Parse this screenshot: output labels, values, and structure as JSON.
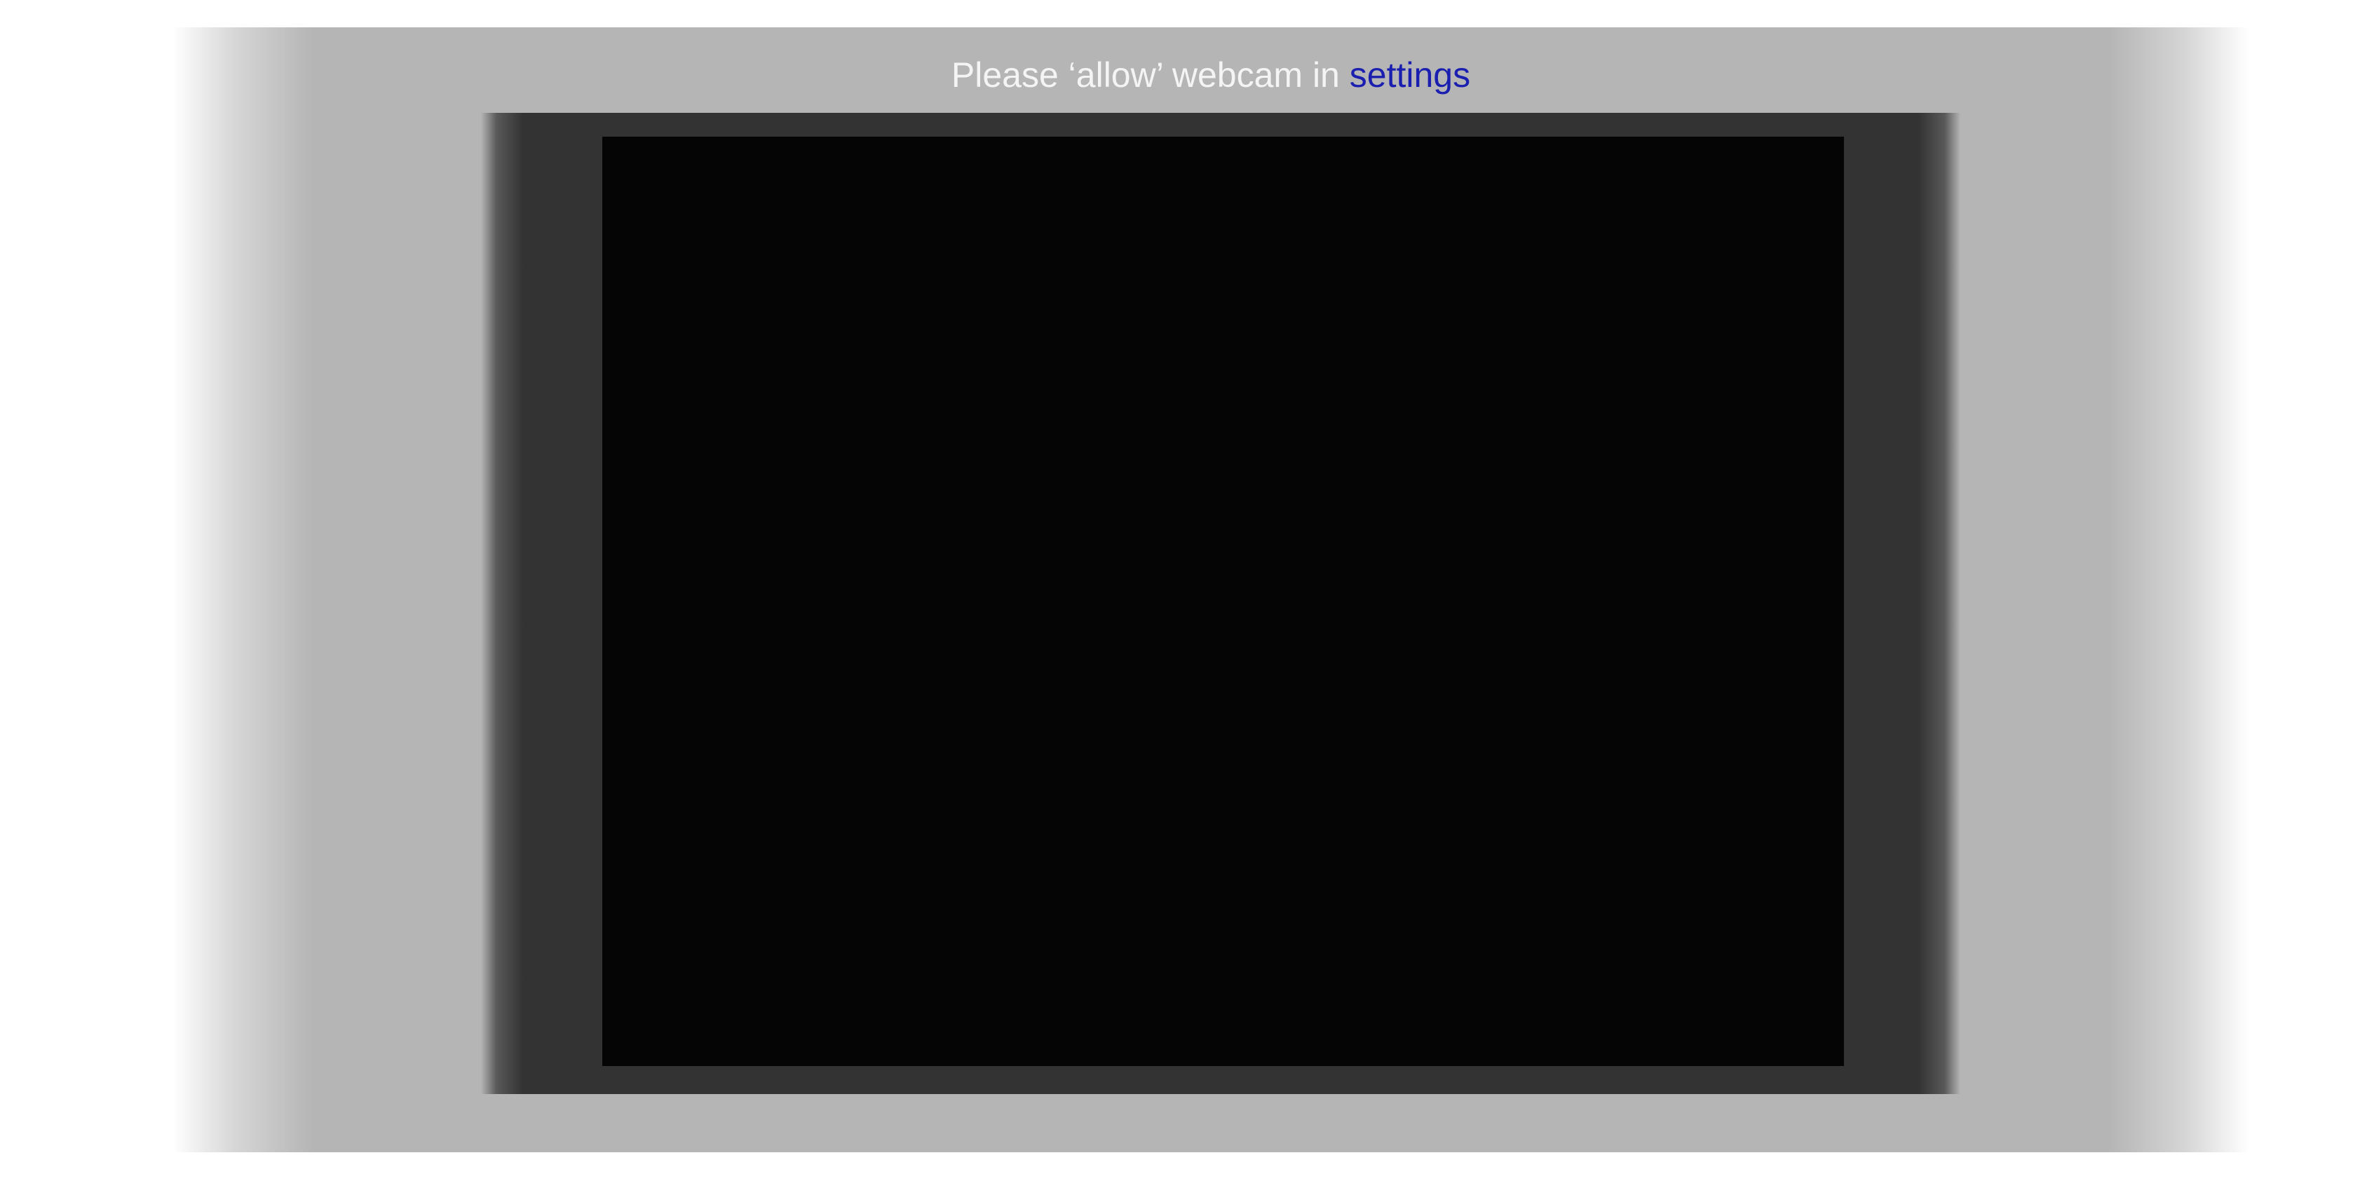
{
  "message": {
    "prefix": "Please ‘allow’ webcam in ",
    "link_label": "settings"
  },
  "colors": {
    "panel_background": "#b5b5b5",
    "frame_background": "#333333",
    "camera_view": "#050505",
    "message_text": "#f4f4f4",
    "link_text": "#1b1fb0"
  }
}
